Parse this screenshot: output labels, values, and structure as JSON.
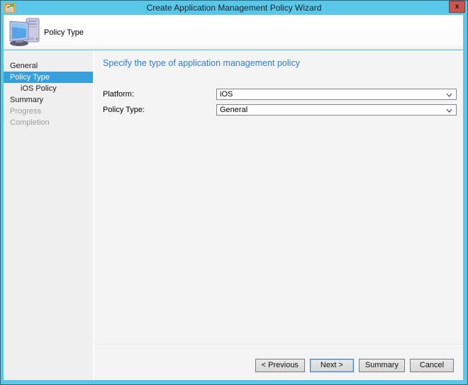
{
  "window": {
    "title": "Create Application Management Policy Wizard",
    "close_label": "x"
  },
  "header": {
    "title": "Policy Type"
  },
  "sidebar": {
    "items": [
      {
        "label": "General",
        "state": "normal"
      },
      {
        "label": "Policy Type",
        "state": "selected"
      },
      {
        "label": "iOS Policy",
        "state": "child"
      },
      {
        "label": "Summary",
        "state": "normal"
      },
      {
        "label": "Progress",
        "state": "disabled"
      },
      {
        "label": "Completion",
        "state": "disabled"
      }
    ]
  },
  "content": {
    "heading": "Specify the type of application management policy",
    "fields": [
      {
        "label": "Platform:",
        "value": "iOS"
      },
      {
        "label": "Policy Type:",
        "value": "General"
      }
    ]
  },
  "footer": {
    "buttons": [
      {
        "label": "< Previous",
        "default": false
      },
      {
        "label": "Next >",
        "default": true
      },
      {
        "label": "Summary",
        "default": false
      },
      {
        "label": "Cancel",
        "default": false
      }
    ]
  },
  "colors": {
    "titlebar": "#5ac7e9",
    "accent_border": "#5ac7e9",
    "selection_blue": "#35a0db",
    "heading_blue": "#2e7cd6",
    "close_red": "#c9564d"
  }
}
